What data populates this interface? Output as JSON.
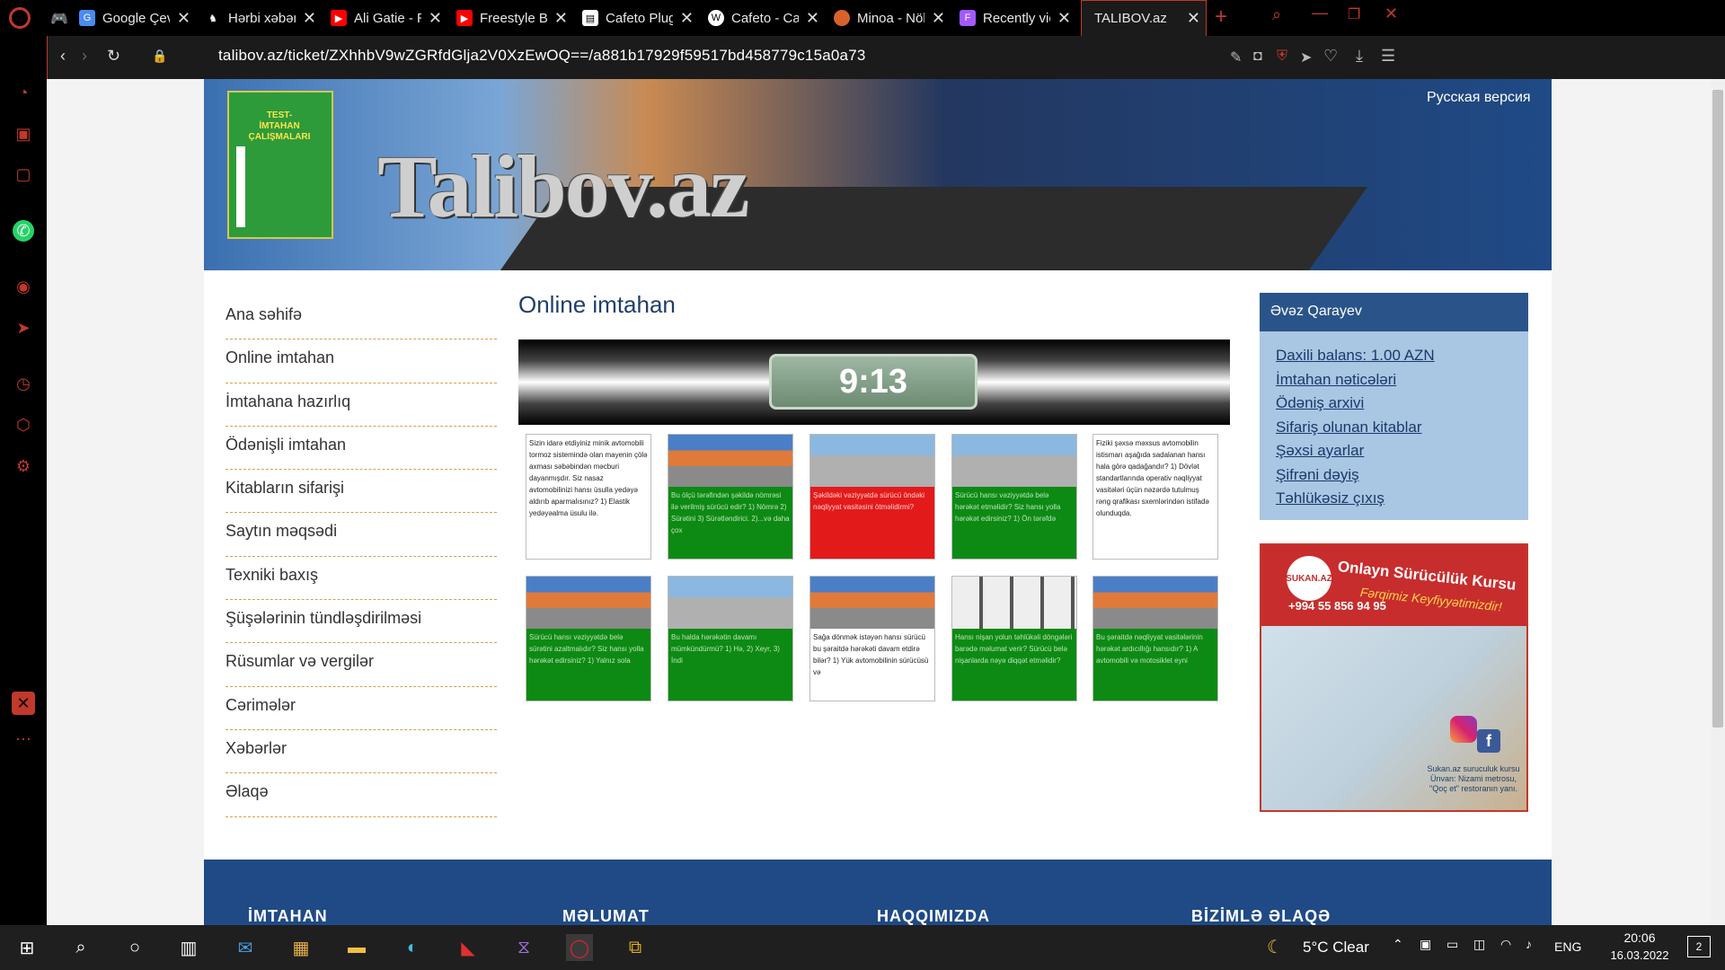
{
  "browser": {
    "tabs": [
      {
        "title": "Google Çeviri",
        "icon": "google-translate-icon",
        "color": "#4a8af4"
      },
      {
        "title": "Hərbi xəbərlər, /",
        "icon": "soldier-icon",
        "color": "#ffffff"
      },
      {
        "title": "Ali Gatie - Runn",
        "icon": "youtube-icon",
        "color": "#ff0000"
      },
      {
        "title": "Freestyle Beat -",
        "icon": "youtube-icon",
        "color": "#ff0000"
      },
      {
        "title": "Cafeto Plugins,",
        "icon": "page-icon",
        "color": "#ffffff"
      },
      {
        "title": "Cafeto - Cafe &",
        "icon": "wordpress-icon",
        "color": "#ffffff"
      },
      {
        "title": "Minoa - Nöbetç",
        "icon": "minoa-icon",
        "color": "#d9622a"
      },
      {
        "title": "Recently viewed",
        "icon": "figma-icon",
        "color": "#a259ff"
      },
      {
        "title": "TALIBOV.az",
        "icon": "",
        "color": "#000000"
      }
    ],
    "url": "talibov.az/ticket/ZXhhbV9wZGRfdGlja2V0XzEwOQ==/a881b17929f59517bd458779c15a0a73"
  },
  "header": {
    "logo_text": "Talibov.az",
    "book_title": "TEST-İMTAHAN ÇALIŞMALARI",
    "language_link": "Русская версия"
  },
  "nav": [
    "Ana səhifə",
    "Online imtahan",
    "İmtahana hazırlıq",
    "Ödənişli imtahan",
    "Kitabların sifarişi",
    "Saytın məqsədi",
    "Texniki baxış",
    "Şüşələrinin tündləşdirilməsi",
    "Rüsumlar və vergilər",
    "Cərimələr",
    "Xəbərlər",
    "Əlaqə"
  ],
  "main": {
    "title": "Online imtahan",
    "timer": "9:13",
    "questions": [
      {
        "style": "white",
        "text": "Sizin idarə etdiyiniz minik avtomobili tormoz sistemində olan mayenin çölə axması səbəbindən məcburi dayanmışdır. Siz nasaz avtomobilinizi hansı üsulla yedəyə aldırıb aparmalısınız? 1) Elastik yedəyəalma üsulu ilə."
      },
      {
        "style": "green",
        "text": "Bu ölçü tərəfindən şəkildə nömrəsi ilə verilmiş sürücü edir? 1) Nömrə 2) Sürətini 3) Sürətləndirici. 2)...və daha çox"
      },
      {
        "style": "red",
        "text": "Şəkildəki vəziyyətdə sürücü öndəki nəqliyyat vasitəsini ötməlidirmi?"
      },
      {
        "style": "green",
        "text": "Sürücü hansı vəziyyətdə belə hərəkət etməlidir? Siz hansı yolla hərəkət edirsiniz? 1) Ön tərəfdə"
      },
      {
        "style": "white",
        "text": "Fiziki şəxsə məxsus avtomobilin istismarı aşağıda sadalanan hansı hala görə qadağandır? 1) Dövlət standartlarında operativ nəqliyyat vasitələri üçün nəzərdə tutulmuş rəng qrafikası sxemlərindən istifadə olunduqda."
      },
      {
        "style": "green",
        "text": "Sürücü hansı vəziyyətdə belə sürətini azaltmalıdır? Siz hansı yolla hərəkət edirsiniz? 1) Yalnız sola"
      },
      {
        "style": "green",
        "text": "Bu halda hərəkətin davamı mümkündürmü? 1) Hə, 2) Xeyr, 3) İndi"
      },
      {
        "style": "split",
        "text": "Sağa dönmək istəyən hansı sürücü bu şəraitdə hərəkəti davam etdirə bilər? 1) Yük avtomobilinin sürücüsü və"
      },
      {
        "style": "green",
        "text": "Hansı nişan yolun təhlükəli döngələri barədə məlumat verir? Sürücü belə nişanlarda nəyə diqqət etməlidir?"
      },
      {
        "style": "green",
        "text": "Bu şəraitdə nəqliyyat vasitələrinin hərəkət ardıcıllığı hansıdır? 1) A avtomobili və motosiklet eyni"
      }
    ]
  },
  "user": {
    "name": "Əvəz Qarayev",
    "links": [
      "Daxili balans: 1.00 AZN",
      "İmtahan nəticələri",
      "Ödəniş arxivi",
      "Sifariş olunan kitablar",
      "Şəxsi ayarlar",
      "Şifrəni dəyiş",
      "Təhlükəsiz çıxış"
    ]
  },
  "ad": {
    "brand": "SUKAN.AZ",
    "headline": "Onlayn Sürücülük Kursu",
    "slogan": "Fərqimiz Keyfiyyətimizdir!",
    "phone": "+994 55 856 94 95",
    "footer_line1": "Sukan.az suruculuk kursu",
    "footer_line2": "Ünvan: Nizami metrosu,",
    "footer_line3": "\"Qoç et\" restoranın yanı."
  },
  "footer": {
    "columns": [
      "İMTAHAN",
      "MƏLUMAT",
      "HAQQIMIZDA",
      "BİZİMLƏ ƏLAQƏ"
    ]
  },
  "taskbar": {
    "weather": "5°C  Clear",
    "language": "ENG",
    "time": "20:06",
    "date": "16.03.2022",
    "notifications": "2"
  }
}
